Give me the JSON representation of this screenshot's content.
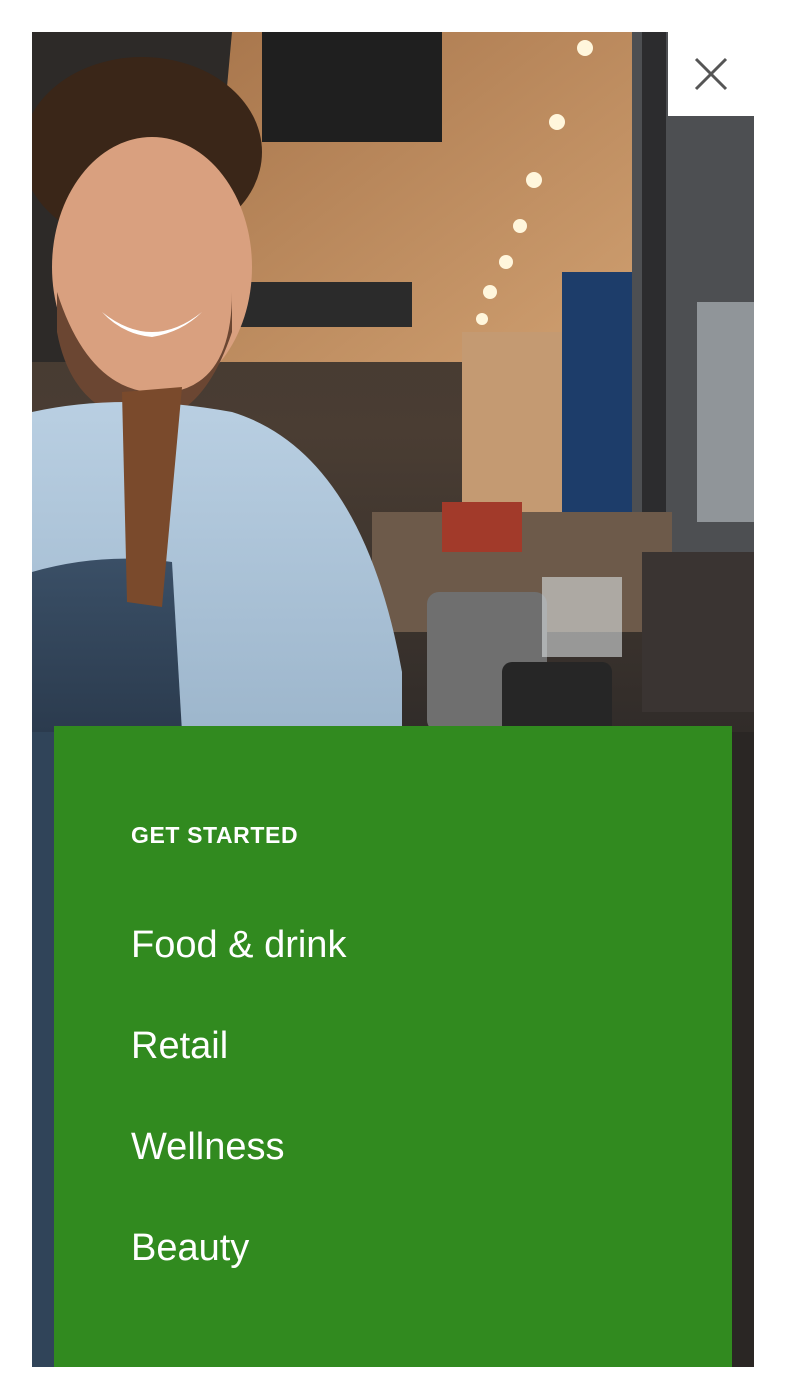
{
  "hero": {
    "image": "barista-smiling-in-coffee-shop"
  },
  "close": {
    "icon": "close-icon"
  },
  "menu": {
    "heading": "GET STARTED",
    "items": [
      {
        "label": "Food & drink"
      },
      {
        "label": "Retail"
      },
      {
        "label": "Wellness"
      },
      {
        "label": "Beauty"
      }
    ]
  },
  "colors": {
    "panel": "#318a1f",
    "text": "#ffffff",
    "close_icon": "#555555"
  }
}
